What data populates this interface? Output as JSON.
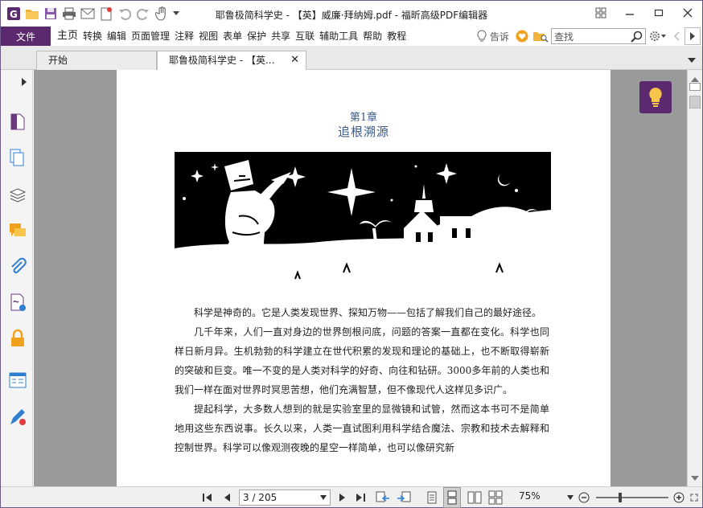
{
  "window": {
    "title": "耶鲁极简科学史 - 【英】威廉·拜纳姆.pdf - 福昕高级PDF编辑器"
  },
  "menubar": {
    "file_label": "文件",
    "items": [
      "主页",
      "转换",
      "编辑",
      "页面管理",
      "注释",
      "视图",
      "表单",
      "保护",
      "共享",
      "互联",
      "辅助工具",
      "帮助",
      "教程"
    ],
    "tell_me_label": "告诉",
    "search_placeholder": "查找"
  },
  "tabs": [
    {
      "label": "开始",
      "active": false
    },
    {
      "label": "耶鲁极简科学史 - 【英...",
      "active": true
    }
  ],
  "sidebar": {
    "icons": [
      "pages-icon",
      "copy-pages-icon",
      "layers-icon",
      "comments-icon",
      "attachments-icon",
      "signature-icon",
      "security-lock-icon",
      "form-fields-icon",
      "pen-signature-icon"
    ]
  },
  "document": {
    "chapter_number": "第1章",
    "chapter_title": "追根溯源",
    "paragraphs": [
      "科学是神奇的。它是人类发现世界、探知万物——包括了解我们自己的最好途径。",
      "几千年来，人们一直对身边的世界刨根问底，问题的答案一直都在变化。科学也同样日新月异。生机勃勃的科学建立在世代积累的发现和理论的基础上，也不断取得崭新的突破和巨变。唯一不变的是人类对科学的好奇、向往和钻研。3000多年前的人类也和我们一样在面对世界时冥思苦想，他们充满智慧，但不像现代人这样见多识广。",
      "提起科学，大多数人想到的就是实验室里的显微镜和试管，然而这本书可不是简单地用这些东西说事。长久以来，人类一直试图利用科学结合魔法、宗教和技术去解释和控制世界。科学可以像观测夜晚的星空一样简单，也可以像研究新"
    ]
  },
  "statusbar": {
    "page_value": "3 / 205",
    "zoom": "75%"
  },
  "colors": {
    "accent": "#5b2a6e",
    "heading": "#3a5a8c",
    "doc_background": "#9a9a9a"
  }
}
